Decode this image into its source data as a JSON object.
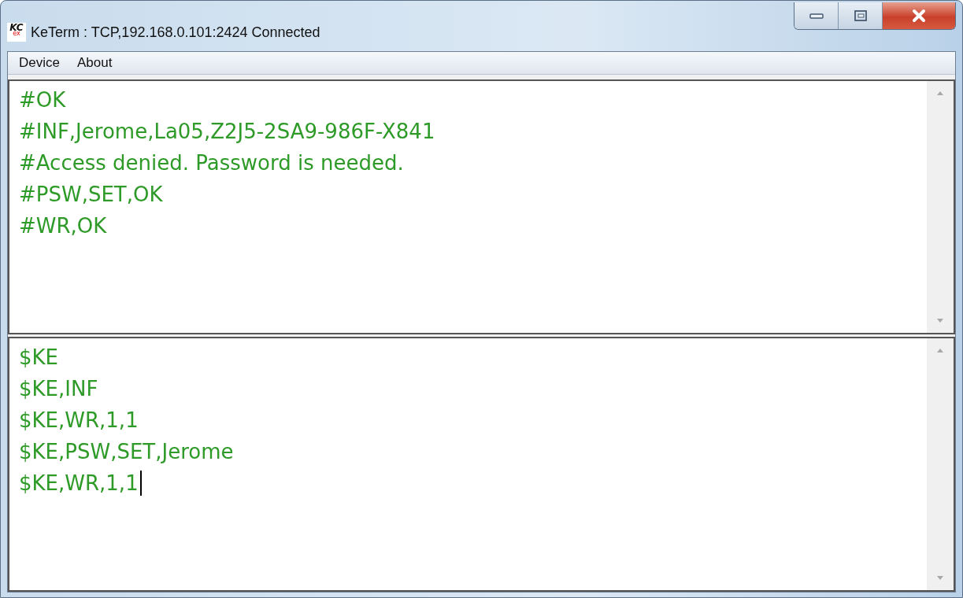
{
  "window": {
    "title": "KeTerm : TCP,192.168.0.101:2424 Connected",
    "app_icon": {
      "main": "KC",
      "sub": "ex"
    }
  },
  "menu": [
    "Device",
    "About"
  ],
  "received": [
    "#OK",
    "#INF,Jerome,La05,Z2J5-2SA9-986F-X841",
    "#Access denied. Password is needed.",
    "#PSW,SET,OK",
    "#WR,OK"
  ],
  "sent": [
    "$KE",
    "$KE,INF",
    "$KE,WR,1,1",
    "$KE,PSW,SET,Jerome",
    "$KE,WR,1,1"
  ]
}
